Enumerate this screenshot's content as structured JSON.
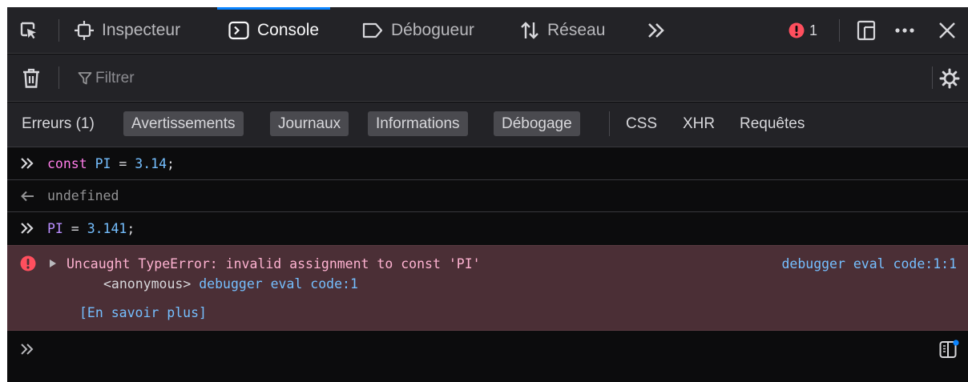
{
  "toolbar": {
    "pick_icon": "element-picker-icon",
    "tabs": [
      {
        "label": "Inspecteur",
        "icon": "inspector-icon"
      },
      {
        "label": "Console",
        "icon": "console-icon"
      },
      {
        "label": "Débogueur",
        "icon": "debugger-icon"
      },
      {
        "label": "Réseau",
        "icon": "network-icon"
      }
    ],
    "overflow_icon": "chevron-double-right-icon",
    "error_count": "1",
    "active_tab": "Console",
    "accent_color": "#0a84ff",
    "error_color": "#ff4f5e"
  },
  "filterbar": {
    "placeholder": "Filtrer",
    "trash_icon": "trash-icon",
    "settings_icon": "gear-icon"
  },
  "categories": {
    "errors": "Erreurs (1)",
    "warnings": "Avertissements",
    "logs": "Journaux",
    "info": "Informations",
    "debug": "Débogage",
    "css": "CSS",
    "xhr": "XHR",
    "requests": "Requêtes"
  },
  "console": {
    "cmd1": {
      "keyword": "const",
      "ident": "PI",
      "op": " = ",
      "value": "3.14",
      "end": ";"
    },
    "result1": "undefined",
    "cmd2": {
      "ident": "PI",
      "op": " = ",
      "value": "3.141",
      "end": ";"
    },
    "error": {
      "message": "Uncaught TypeError: invalid assignment to const 'PI'",
      "location": "debugger eval code:1:1",
      "stack_fn": "<anonymous>",
      "stack_loc": "debugger eval code:1",
      "learn_more": "[En savoir plus]"
    }
  }
}
